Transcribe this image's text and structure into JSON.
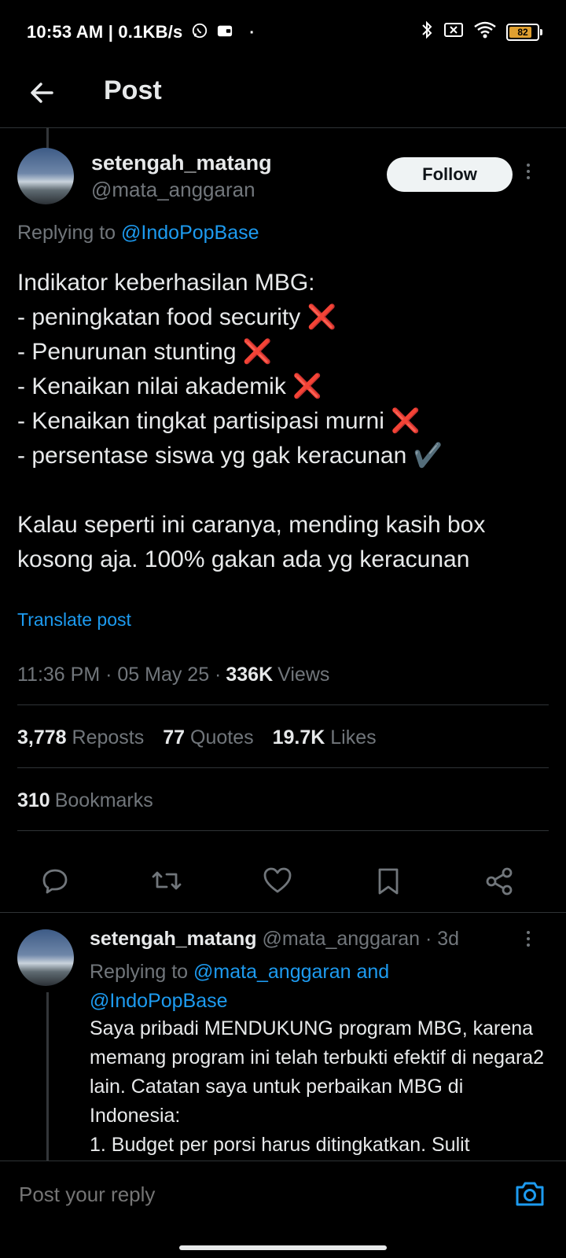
{
  "status_bar": {
    "text": "10:53 AM | 0.1KB/s",
    "battery": "82",
    "battery_level": 0.82
  },
  "header": {
    "title": "Post",
    "back_icon": "arrow-left-icon"
  },
  "tweet": {
    "display_name": "setengah_matang",
    "handle": "@mata_anggaran",
    "follow_label": "Follow",
    "replying_prefix": "Replying to",
    "replying_to": "@IndoPopBase",
    "body": "Indikator keberhasilan MBG:\n- peningkatan food security ❌\n- Penurunan stunting ❌\n- Kenaikan nilai akademik ❌\n- Kenaikan tingkat partisipasi murni ❌\n- persentase siswa yg gak keracunan ✔️\n\nKalau seperti ini caranya, mending kasih box kosong aja. 100% gakan ada yg keracunan",
    "translate_label": "Translate post",
    "meta_time": "11:36 PM · 05 May 25 ·",
    "views_count": "336K",
    "views_label": "Views",
    "reposts_count": "3,778",
    "reposts_label": "Reposts",
    "quotes_count": "77",
    "quotes_label": "Quotes",
    "likes_count": "19.7K",
    "likes_label": "Likes",
    "bookmarks_count": "310",
    "bookmarks_label": "Bookmarks"
  },
  "reply": {
    "display_name": "setengah_matang",
    "handle": "@mata_anggaran",
    "time": "· 3d",
    "replying_prefix": "Replying to",
    "replying_to_1": "@mata_anggaran and",
    "replying_to_2": "@IndoPopBase",
    "body": "Saya pribadi MENDUKUNG program MBG, karena memang program ini telah terbukti efektif di negara2 lain. Catatan saya untuk perbaikan MBG di Indonesia:\n1. Budget per porsi harus ditingkatkan. Sulit"
  },
  "composer": {
    "placeholder": "Post your reply"
  },
  "colors": {
    "accent": "#1d9bf0",
    "background": "#000000",
    "muted": "#71767b"
  }
}
